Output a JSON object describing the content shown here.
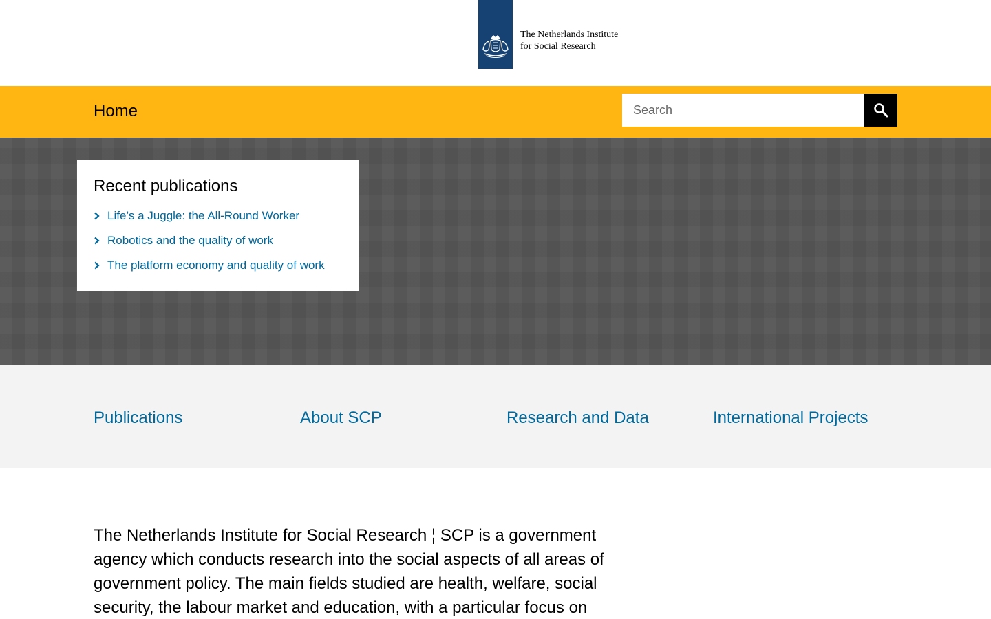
{
  "header": {
    "logo_line1": "The Netherlands Institute",
    "logo_line2": "for Social Research",
    "logo_emblem": "crest-icon",
    "brand_color": "#154273"
  },
  "nav": {
    "home_label": "Home",
    "bar_color": "#ffb612"
  },
  "search": {
    "placeholder": "Search",
    "value": "",
    "button_icon": "search-icon"
  },
  "recent": {
    "title": "Recent publications",
    "items": [
      {
        "label": "Life’s a Juggle: the All-Round Worker"
      },
      {
        "label": "Robotics and the quality of work"
      },
      {
        "label": "The platform economy and quality of work"
      }
    ]
  },
  "quick_links": [
    {
      "label": "Publications"
    },
    {
      "label": "About SCP"
    },
    {
      "label": "Research and Data"
    },
    {
      "label": "International Projects"
    }
  ],
  "intro": {
    "text": "The Netherlands Institute for Social Research ¦ SCP is a government agency which conducts research into the social aspects of all areas of government policy. The main fields studied are health, welfare, social security, the labour market and education, with a particular focus on"
  },
  "colors": {
    "link": "#01689b",
    "hero_bg": "#555555",
    "band_bg": "#f3f3f3"
  }
}
